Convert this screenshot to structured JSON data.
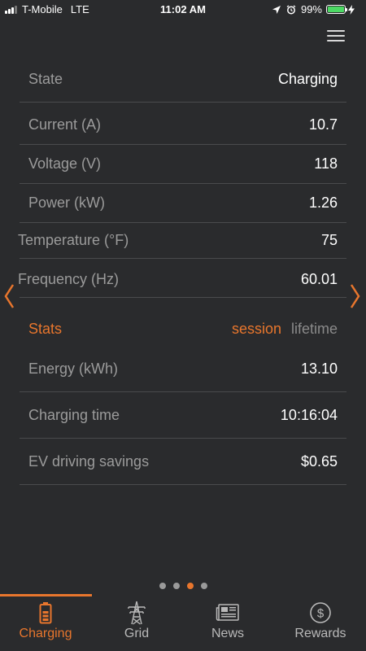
{
  "status_bar": {
    "carrier": "T-Mobile",
    "network": "LTE",
    "time": "11:02 AM",
    "battery": "99%"
  },
  "colors": {
    "accent": "#e8762d",
    "background": "#2a2b2d",
    "label": "#9b9b9b",
    "divider": "#4a4b4d"
  },
  "icons": {
    "menu": "hamburger-icon",
    "location": "location-arrow-icon",
    "alarm": "alarm-icon",
    "charging_bolt": "bolt-icon"
  },
  "status": {
    "state_label": "State",
    "state_value": "Charging",
    "current_label": "Current (A)",
    "current_value": "10.7",
    "voltage_label": "Voltage (V)",
    "voltage_value": "118",
    "power_label": "Power (kW)",
    "power_value": "1.26",
    "temperature_label": "Temperature (°F)",
    "temperature_value": "75",
    "frequency_label": "Frequency (Hz)",
    "frequency_value": "60.01"
  },
  "stats": {
    "title": "Stats",
    "tab_session": "session",
    "tab_lifetime": "lifetime",
    "active_tab": "session",
    "energy_label": "Energy (kWh)",
    "energy_value": "13.10",
    "charging_time_label": "Charging time",
    "charging_time_value": "10:16:04",
    "savings_label": "EV driving savings",
    "savings_value": "$0.65"
  },
  "pager": {
    "page_count": 4,
    "active_page": 3
  },
  "tabbar": {
    "tabs": [
      {
        "label": "Charging",
        "icon": "battery-icon",
        "active": true
      },
      {
        "label": "Grid",
        "icon": "power-tower-icon",
        "active": false
      },
      {
        "label": "News",
        "icon": "newspaper-icon",
        "active": false
      },
      {
        "label": "Rewards",
        "icon": "dollar-coin-icon",
        "active": false
      }
    ]
  }
}
